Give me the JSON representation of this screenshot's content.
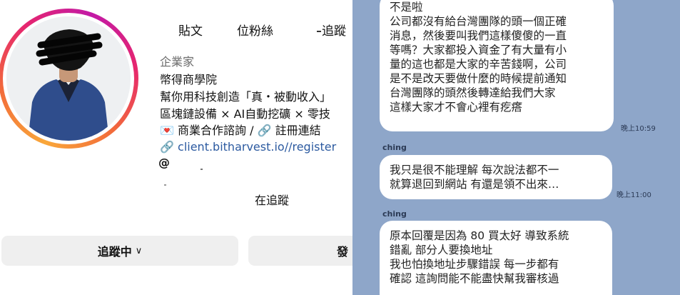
{
  "profile": {
    "stats": {
      "posts_label": "貼文",
      "followers_label": "位粉絲",
      "following_label": "追蹤"
    },
    "category": "企業家",
    "name": "幣得商學院",
    "bio_line1": "幫你用科技創造「真・被動收入」",
    "bio_line2": "區塊鏈設備 × AI自動挖礦 × 零技",
    "bio_line3": "商業合作諮詢 / 🔗 註冊連結",
    "link": "client.bitharvest.io//register",
    "following_status": "在追蹤",
    "following_button": "追蹤中",
    "message_button": "發"
  },
  "chat": {
    "messages": [
      {
        "sender": "",
        "lines": [
          "不是啦",
          "公司都沒有給台灣團隊的頭一個正確",
          "消息，然後要叫我們這樣傻傻的一直",
          "等嗎？大家都投入資金了有大量有小",
          "量的這也都是大家的辛苦錢啊，公司",
          "是不是改天要做什麼的時候提前通知",
          "台灣團隊的頭然後轉達給我們大家",
          "這樣大家才不會心裡有疙瘩"
        ],
        "time": "晚上10:59"
      },
      {
        "sender": "ching",
        "lines": [
          "我只是很不能理解 每次說法都不一",
          "就算退回到網站 有還是領不出來…"
        ],
        "time": "晚上11:00"
      },
      {
        "sender": "ching",
        "lines": [
          "原本回覆是因為 80 買太好 導致系統",
          "錯亂 部分人要換地址",
          "我也怕換地址步驟錯誤 每一步都有",
          "確認 這詢問能不能盡快幫我審核過"
        ],
        "time": ""
      }
    ]
  }
}
